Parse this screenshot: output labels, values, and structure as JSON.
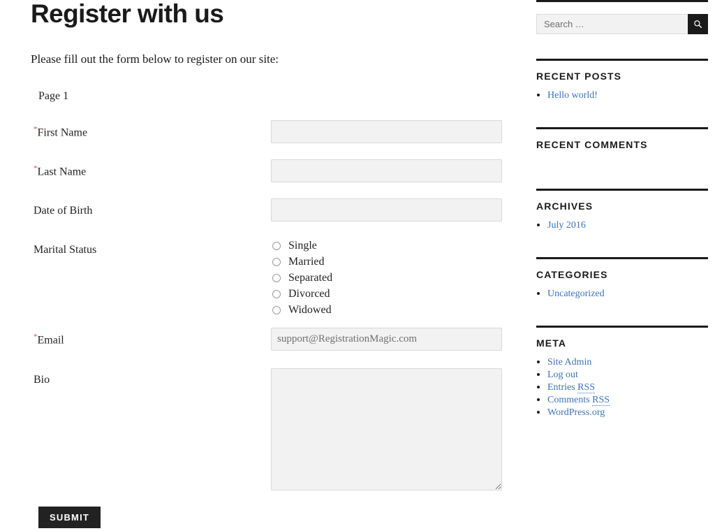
{
  "main": {
    "title": "Register with us",
    "intro": "Please fill out the form below to register on our site:",
    "page_label": "Page 1",
    "submit_label": "Submit",
    "fields": [
      {
        "label": "First Name",
        "required": true,
        "type": "text",
        "value": "",
        "placeholder": ""
      },
      {
        "label": "Last Name",
        "required": true,
        "type": "text",
        "value": "",
        "placeholder": ""
      },
      {
        "label": "Date of Birth",
        "required": false,
        "type": "text",
        "value": "",
        "placeholder": ""
      },
      {
        "label": "Marital Status",
        "required": false,
        "type": "radio",
        "options": [
          "Single",
          "Married",
          "Separated",
          "Divorced",
          "Widowed"
        ],
        "selected": ""
      },
      {
        "label": "Email",
        "required": true,
        "type": "text",
        "value": "",
        "placeholder": "support@RegistrationMagic.com"
      },
      {
        "label": "Bio",
        "required": false,
        "type": "textarea",
        "value": "",
        "placeholder": ""
      }
    ]
  },
  "sidebar": {
    "search": {
      "placeholder": "Search …",
      "value": "",
      "icon": "search-icon"
    },
    "widgets": [
      {
        "title": "Recent Posts",
        "items": [
          {
            "label": "Hello world!"
          }
        ]
      },
      {
        "title": "Recent Comments",
        "items": []
      },
      {
        "title": "Archives",
        "items": [
          {
            "label": "July 2016"
          }
        ]
      },
      {
        "title": "Categories",
        "items": [
          {
            "label": "Uncategorized"
          }
        ]
      },
      {
        "title": "Meta",
        "items": [
          {
            "label": "Site Admin"
          },
          {
            "label": "Log out"
          },
          {
            "label": "Entries RSS",
            "abbr": "RSS"
          },
          {
            "label": "Comments RSS",
            "abbr": "RSS"
          },
          {
            "label": "WordPress.org"
          }
        ]
      }
    ]
  },
  "colors": {
    "link": "#3a73b8",
    "required_star": "#e8423f",
    "rule": "#1a1a1a",
    "button": "#222222",
    "field_bg": "#f2f2f2"
  }
}
